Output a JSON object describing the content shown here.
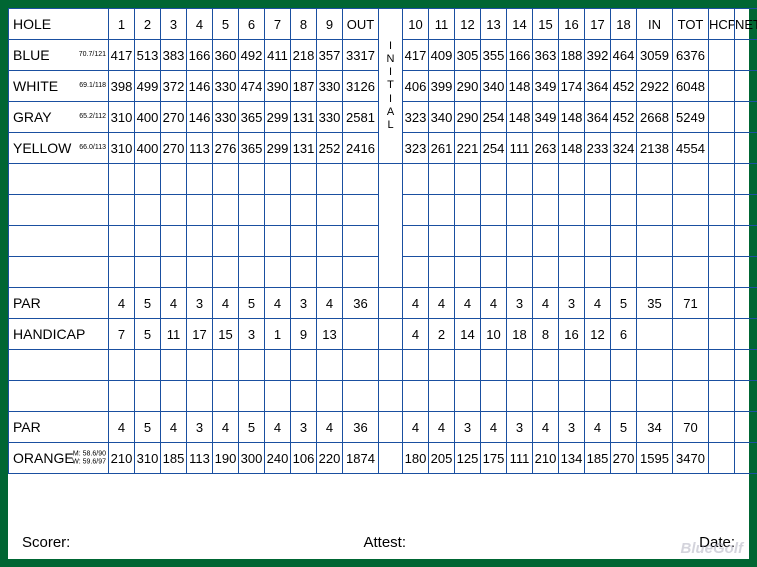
{
  "header": {
    "hole_label": "HOLE",
    "holes_front": [
      "1",
      "2",
      "3",
      "4",
      "5",
      "6",
      "7",
      "8",
      "9"
    ],
    "out_label": "OUT",
    "initial_label": "INITIAL",
    "holes_back": [
      "10",
      "11",
      "12",
      "13",
      "14",
      "15",
      "16",
      "17",
      "18"
    ],
    "in_label": "IN",
    "tot_label": "TOT",
    "hcp_label": "HCP",
    "net_label": "NET"
  },
  "tees": [
    {
      "name": "BLUE",
      "rating": "70.7/121",
      "front": [
        "417",
        "513",
        "383",
        "166",
        "360",
        "492",
        "411",
        "218",
        "357"
      ],
      "out": "3317",
      "back": [
        "417",
        "409",
        "305",
        "355",
        "166",
        "363",
        "188",
        "392",
        "464"
      ],
      "in": "3059",
      "tot": "6376"
    },
    {
      "name": "WHITE",
      "rating": "69.1/118",
      "front": [
        "398",
        "499",
        "372",
        "146",
        "330",
        "474",
        "390",
        "187",
        "330"
      ],
      "out": "3126",
      "back": [
        "406",
        "399",
        "290",
        "340",
        "148",
        "349",
        "174",
        "364",
        "452"
      ],
      "in": "2922",
      "tot": "6048"
    },
    {
      "name": "GRAY",
      "rating": "65.2/112",
      "front": [
        "310",
        "400",
        "270",
        "146",
        "330",
        "365",
        "299",
        "131",
        "330"
      ],
      "out": "2581",
      "back": [
        "323",
        "340",
        "290",
        "254",
        "148",
        "349",
        "148",
        "364",
        "452"
      ],
      "in": "2668",
      "tot": "5249"
    },
    {
      "name": "YELLOW",
      "rating": "66.0/113",
      "front": [
        "310",
        "400",
        "270",
        "113",
        "276",
        "365",
        "299",
        "131",
        "252"
      ],
      "out": "2416",
      "back": [
        "323",
        "261",
        "221",
        "254",
        "111",
        "263",
        "148",
        "233",
        "324"
      ],
      "in": "2138",
      "tot": "4554"
    }
  ],
  "par": {
    "label": "PAR",
    "front": [
      "4",
      "5",
      "4",
      "3",
      "4",
      "5",
      "4",
      "3",
      "4"
    ],
    "out": "36",
    "back": [
      "4",
      "4",
      "4",
      "4",
      "3",
      "4",
      "3",
      "4",
      "5"
    ],
    "in": "35",
    "tot": "71"
  },
  "handicap": {
    "label": "HANDICAP",
    "front": [
      "7",
      "5",
      "11",
      "17",
      "15",
      "3",
      "1",
      "9",
      "13"
    ],
    "out": "",
    "back": [
      "4",
      "2",
      "14",
      "10",
      "18",
      "8",
      "16",
      "12",
      "6"
    ],
    "in": "",
    "tot": ""
  },
  "par2": {
    "label": "PAR",
    "front": [
      "4",
      "5",
      "4",
      "3",
      "4",
      "5",
      "4",
      "3",
      "4"
    ],
    "out": "36",
    "back": [
      "4",
      "4",
      "3",
      "4",
      "3",
      "4",
      "3",
      "4",
      "5"
    ],
    "in": "34",
    "tot": "70"
  },
  "orange": {
    "name": "ORANGE",
    "rating_line1": "M: 58.6/90",
    "rating_line2": "W: 59.6/97",
    "front": [
      "210",
      "310",
      "185",
      "113",
      "190",
      "300",
      "240",
      "106",
      "220"
    ],
    "out": "1874",
    "back": [
      "180",
      "205",
      "125",
      "175",
      "111",
      "210",
      "134",
      "185",
      "270"
    ],
    "in": "1595",
    "tot": "3470"
  },
  "footer": {
    "scorer": "Scorer:",
    "attest": "Attest:",
    "date": "Date:"
  },
  "watermark": "BlueGolf"
}
